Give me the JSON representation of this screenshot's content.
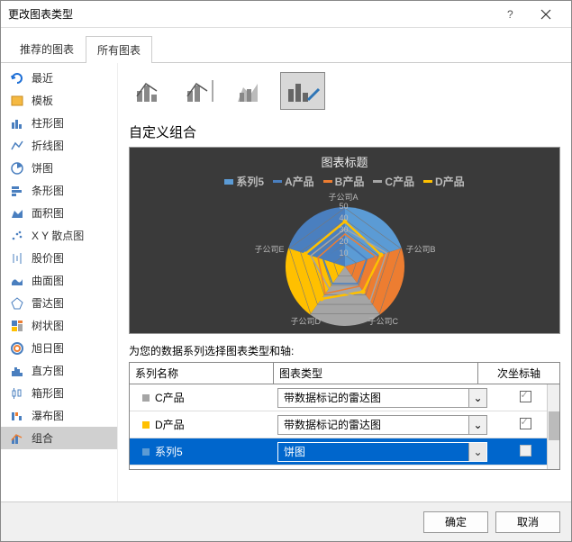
{
  "window": {
    "title": "更改图表类型"
  },
  "tabs": {
    "recommended": "推荐的图表",
    "all": "所有图表"
  },
  "sidebar": [
    {
      "label": "最近",
      "icon": "recent"
    },
    {
      "label": "模板",
      "icon": "template"
    },
    {
      "label": "柱形图",
      "icon": "column"
    },
    {
      "label": "折线图",
      "icon": "line"
    },
    {
      "label": "饼图",
      "icon": "pie"
    },
    {
      "label": "条形图",
      "icon": "bar"
    },
    {
      "label": "面积图",
      "icon": "area"
    },
    {
      "label": "X Y 散点图",
      "icon": "scatter"
    },
    {
      "label": "股价图",
      "icon": "stock"
    },
    {
      "label": "曲面图",
      "icon": "surface"
    },
    {
      "label": "雷达图",
      "icon": "radar"
    },
    {
      "label": "树状图",
      "icon": "tree"
    },
    {
      "label": "旭日图",
      "icon": "sunburst"
    },
    {
      "label": "直方图",
      "icon": "histogram"
    },
    {
      "label": "箱形图",
      "icon": "box"
    },
    {
      "label": "瀑布图",
      "icon": "waterfall"
    },
    {
      "label": "组合",
      "icon": "combo"
    }
  ],
  "main": {
    "section_title": "自定义组合",
    "preview": {
      "title": "图表标题",
      "legend": [
        {
          "name": "系列5",
          "color": "#5b9bd5"
        },
        {
          "name": "A产品",
          "color": "#4a7fbf"
        },
        {
          "name": "B产品",
          "color": "#ed7d31"
        },
        {
          "name": "C产品",
          "color": "#a5a5a5"
        },
        {
          "name": "D产品",
          "color": "#ffc000"
        }
      ],
      "radar_labels": [
        "子公司A",
        "子公司B",
        "子公司C",
        "子公司D",
        "子公司E"
      ],
      "radar_ticks": [
        "10",
        "20",
        "30",
        "40",
        "50"
      ]
    },
    "series_section_label": "为您的数据系列选择图表类型和轴:",
    "grid_headers": {
      "name": "系列名称",
      "type": "图表类型",
      "axis": "次坐标轴"
    },
    "rows": [
      {
        "name": "C产品",
        "color": "#a5a5a5",
        "type": "带数据标记的雷达图",
        "secondary": true,
        "secondary_enabled": true
      },
      {
        "name": "D产品",
        "color": "#ffc000",
        "type": "带数据标记的雷达图",
        "secondary": true,
        "secondary_enabled": true
      },
      {
        "name": "系列5",
        "color": "#5b9bd5",
        "type": "饼图",
        "secondary": false,
        "secondary_enabled": false,
        "selected": true
      }
    ]
  },
  "footer": {
    "ok": "确定",
    "cancel": "取消"
  }
}
